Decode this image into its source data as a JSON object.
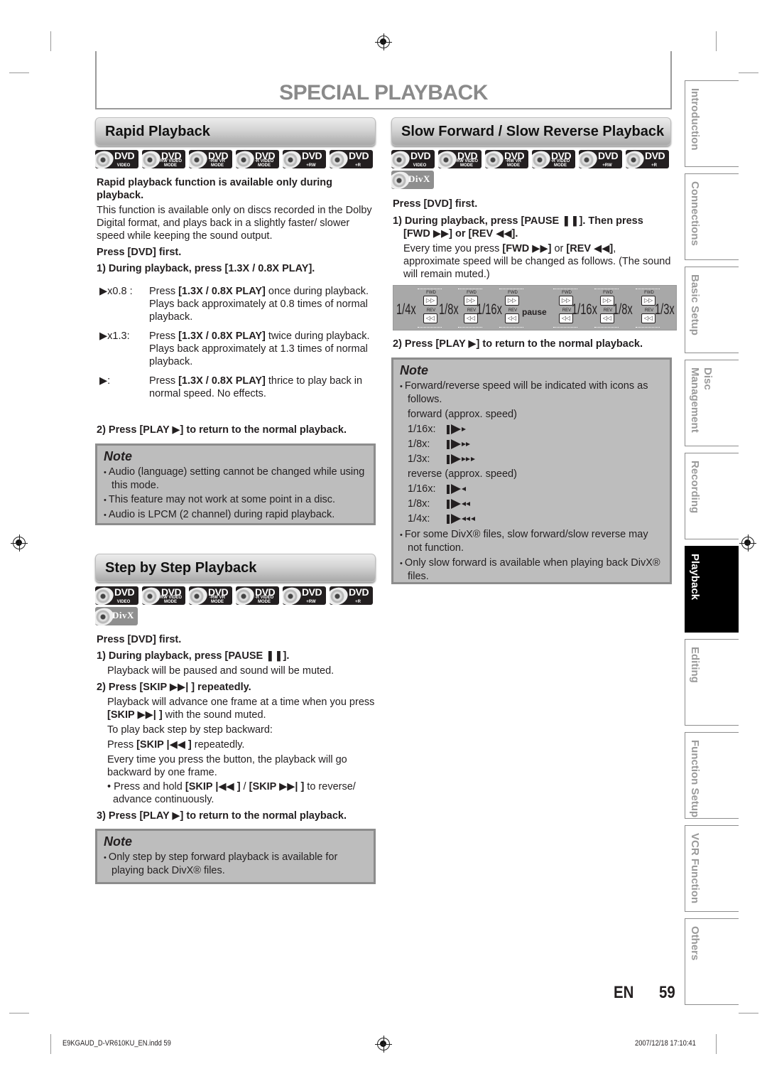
{
  "page": {
    "title": "SPECIAL PLAYBACK",
    "lang": "EN",
    "number": "59"
  },
  "disc_icons": {
    "standard": [
      {
        "label": "DVD",
        "sub": "VIDEO"
      },
      {
        "label": "DVD",
        "sub": "-RW VIDEO MODE"
      },
      {
        "label": "DVD",
        "sub": "-RW VR MODE"
      },
      {
        "label": "DVD",
        "sub": "-R VIDEO MODE"
      },
      {
        "label": "DVD",
        "sub": "+RW"
      },
      {
        "label": "DVD",
        "sub": "+R"
      }
    ],
    "divx": {
      "label": "DivX"
    }
  },
  "rapid": {
    "heading": "Rapid Playback",
    "intro_bold": "Rapid playback function is available only during playback.",
    "intro": "This function is available only on discs recorded in the Dolby Digital format, and plays back in a slightly faster/ slower speed while keeping the sound output.",
    "press_dvd": "Press [DVD] first.",
    "step1": "1) During playback, press [1.3X / 0.8X PLAY].",
    "modes": [
      {
        "indicator": "x0.8 :",
        "pre": "Press ",
        "key": "[1.3X / 0.8X PLAY]",
        "post": " once during playback. Plays back approximately at 0.8 times of normal playback."
      },
      {
        "indicator": "x1.3:",
        "pre": "Press ",
        "key": "[1.3X / 0.8X PLAY]",
        "post": " twice during playback. Plays back approximately at 1.3 times of normal playback."
      },
      {
        "indicator": ":",
        "pre": "Press ",
        "key": "[1.3X / 0.8X PLAY]",
        "post": " thrice to play back in normal speed. No effects."
      }
    ],
    "step2": "2) Press [PLAY ▶] to return to the normal playback.",
    "note": {
      "title": "Note",
      "items": [
        "Audio (language) setting cannot be changed while using this mode.",
        "This feature may not work at some point in a disc.",
        "Audio is LPCM (2 channel) during rapid playback."
      ]
    }
  },
  "step": {
    "heading": "Step by Step Playback",
    "press_dvd": "Press [DVD] first.",
    "step1": "1) During playback, press [PAUSE ❚❚].",
    "step1_desc": "Playback will be paused and sound will be muted.",
    "step2": "2) Press [SKIP ▶▶| ] repeatedly.",
    "step2_desc_pre": "Playback will advance one frame at a time when you press ",
    "step2_desc_key": "[SKIP ▶▶| ]",
    "step2_desc_post": " with the sound muted.",
    "backward_intro": "To play back step by step backward:",
    "backward_pre": "Press ",
    "backward_key": "[SKIP |◀◀ ]",
    "backward_post": " repeatedly.",
    "backward_desc": "Every time you press the button, the playback will go backward by one frame.",
    "hold_pre": "Press and hold ",
    "hold_key1": "[SKIP |◀◀ ]",
    "hold_mid": " / ",
    "hold_key2": "[SKIP ▶▶| ]",
    "hold_post": " to reverse/ advance continuously.",
    "step3": "3) Press [PLAY ▶] to return to the normal playback.",
    "note": {
      "title": "Note",
      "items": [
        "Only step by step forward playback is available for playing back DivX® files."
      ]
    }
  },
  "slow": {
    "heading": "Slow Forward / Slow Reverse Playback",
    "press_dvd": "Press [DVD] first.",
    "step1": "1) During playback, press [PAUSE ❚❚]. Then press [FWD ▶▶] or [REV ◀◀].",
    "step1_pre": "Every time you press ",
    "step1_key1": "[FWD ▶▶]",
    "step1_mid": " or ",
    "step1_key2": "[REV ◀◀]",
    "step1_post": ", approximate speed will be changed as follows. (The sound will remain muted.)",
    "diagram": {
      "speeds": [
        "1/4x",
        "1/8x",
        "1/16x",
        "pause",
        "1/16x",
        "1/8x",
        "1/3x"
      ],
      "fwd_label": "FWD",
      "rev_label": "REV"
    },
    "step2": "2) Press [PLAY ▶] to return to the normal playback.",
    "note": {
      "title": "Note",
      "intro": "Forward/reverse speed will be indicated with icons as follows.",
      "forward_title": "forward (approx. speed)",
      "forward": [
        {
          "label": "1/16x:",
          "marks": 1
        },
        {
          "label": "1/8x:",
          "marks": 2
        },
        {
          "label": "1/3x:",
          "marks": 3
        }
      ],
      "reverse_title": "reverse (approx. speed)",
      "reverse": [
        {
          "label": "1/16x:",
          "marks": 1
        },
        {
          "label": "1/8x:",
          "marks": 2
        },
        {
          "label": "1/4x:",
          "marks": 3
        }
      ],
      "items": [
        "For some DivX® files, slow forward/slow reverse may not function.",
        "Only slow forward is available when playing back DivX® files."
      ]
    }
  },
  "side_tabs": [
    {
      "label": "Introduction",
      "active": false
    },
    {
      "label": "Connections",
      "active": false
    },
    {
      "label": "Basic Setup",
      "active": false
    },
    {
      "label": "Disc\nManagement",
      "active": false
    },
    {
      "label": "Recording",
      "active": false
    },
    {
      "label": "Playback",
      "active": true
    },
    {
      "label": "Editing",
      "active": false
    },
    {
      "label": "Function Setup",
      "active": false
    },
    {
      "label": "VCR Function",
      "active": false
    },
    {
      "label": "Others",
      "active": false
    }
  ],
  "footer": {
    "file": "E9KGAUD_D-VR610KU_EN.indd   59",
    "timestamp": "2007/12/18   17:10:41"
  }
}
